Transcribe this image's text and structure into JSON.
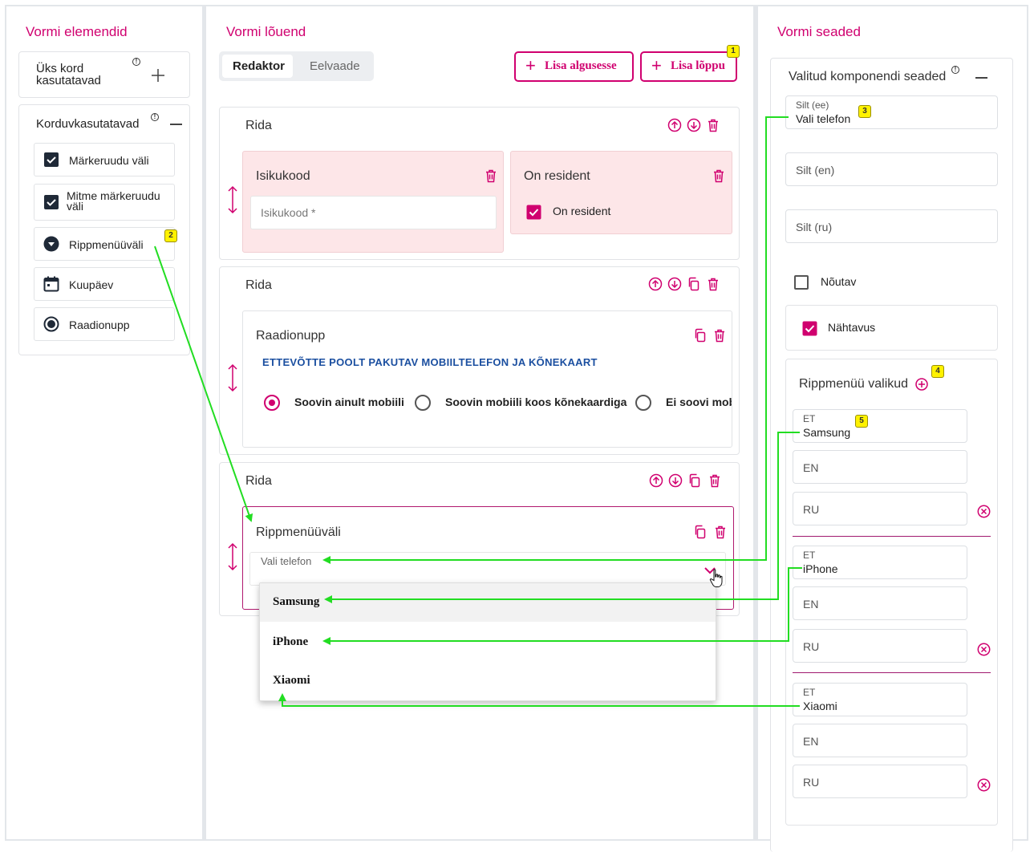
{
  "left_panel": {
    "title": "Vormi elemendid",
    "single_use": {
      "label_line1": "Üks kord",
      "label_line2": "kasutatavad"
    },
    "reusable": {
      "label": "Korduvkasutatavad",
      "items": [
        {
          "label": "Märkeruudu väli",
          "icon": "checkbox-icon"
        },
        {
          "label_line1": "Mitme märkeruudu",
          "label_line2": "väli",
          "icon": "checkbox-icon"
        },
        {
          "label": "Rippmenüüväli",
          "icon": "dropdown-icon"
        },
        {
          "label": "Kuupäev",
          "icon": "calendar-icon"
        },
        {
          "label": "Raadionupp",
          "icon": "radio-icon"
        }
      ]
    }
  },
  "canvas": {
    "title": "Vormi lõuend",
    "tabs": [
      "Redaktor",
      "Eelvaade"
    ],
    "btn_add_start": "Lisa algusesse",
    "btn_add_end": "Lisa lõppu",
    "rows": [
      {
        "title": "Rida",
        "components": [
          {
            "title": "Isikukood",
            "placeholder": "Isikukood *"
          },
          {
            "title": "On resident",
            "checkbox_label": "On resident"
          }
        ]
      },
      {
        "title": "Rida",
        "component": {
          "title": "Raadionupp",
          "question": "ETTEVÕTTE POOLT PAKUTAV MOBIILTELEFON JA KÕNEKAART",
          "options": [
            "Soovin ainult mobiili",
            "Soovin mobiili koos kõnekaardiga",
            "Ei soovi mob"
          ]
        }
      },
      {
        "title": "Rida",
        "component": {
          "title": "Rippmenüüväli",
          "select_label": "Vali telefon",
          "options": [
            "Samsung",
            "iPhone",
            "Xiaomi"
          ]
        }
      }
    ]
  },
  "settings": {
    "title": "Vormi seaded",
    "section_title": "Valitud komponendi seaded",
    "label_ee": {
      "label": "Silt (ee)",
      "value": "Vali telefon"
    },
    "label_en": "Silt (en)",
    "label_ru": "Silt (ru)",
    "required": {
      "label": "Nõutav",
      "checked": false
    },
    "visible": {
      "label": "Nähtavus",
      "checked": true
    },
    "options_title": "Rippmenüü valikud",
    "options": [
      {
        "et_label": "ET",
        "et_value": "Samsung",
        "en": "EN",
        "ru": "RU"
      },
      {
        "et_label": "ET",
        "et_value": "iPhone",
        "en": "EN",
        "ru": "RU"
      },
      {
        "et_label": "ET",
        "et_value": "Xiaomi",
        "en": "EN",
        "ru": "RU"
      }
    ]
  },
  "badges": [
    "1",
    "2",
    "3",
    "4",
    "5"
  ],
  "colors": {
    "accent": "#d0006f",
    "arrow": "#22dd22",
    "question_blue": "#1b4fa0"
  }
}
